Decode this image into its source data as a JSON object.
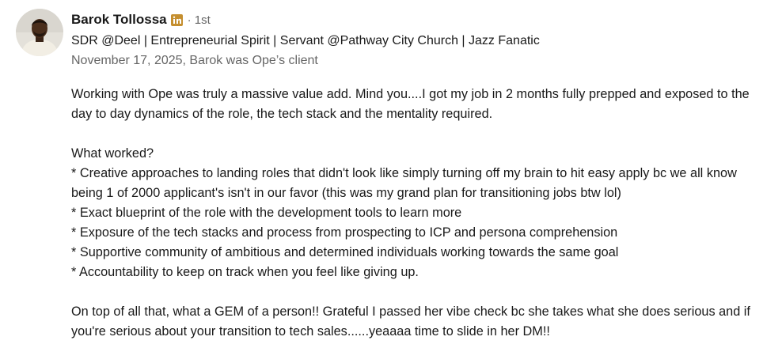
{
  "recommendation": {
    "author": {
      "name": "Barok Tollossa",
      "badge_icon": "linkedin-icon",
      "degree": "· 1st",
      "headline": "SDR @Deel | Entrepreneurial Spirit | Servant @Pathway City Church | Jazz Fanatic",
      "meta": "November 17, 2025, Barok was Ope’s client"
    },
    "body": {
      "p1": "Working with Ope was truly a massive value add. Mind you....I got my job in 2 months fully prepped and exposed to the day to day dynamics of the role, the tech stack and the mentality required.",
      "p2": "What worked?\n* Creative approaches to landing roles that didn't look like simply turning off my brain to hit easy apply bc we all know being 1 of 2000 applicant's isn't in our favor (this was my grand plan for transitioning jobs btw lol)\n* Exact blueprint of the role with the development tools to learn more\n* Exposure of the tech stacks and process from prospecting to ICP and persona comprehension\n* Supportive community of ambitious and determined individuals working towards the same goal\n* Accountability to keep on track when you feel like giving up.",
      "p3": "On top of all that, what a GEM of a person!! Grateful I passed her vibe check bc she takes what she does serious and if you're serious about your transition to tech sales......yeaaaa time to slide in her DM!!"
    }
  },
  "colors": {
    "text_primary": "#191919",
    "text_secondary": "#666666",
    "linkedin_badge": "#c58f2f"
  }
}
